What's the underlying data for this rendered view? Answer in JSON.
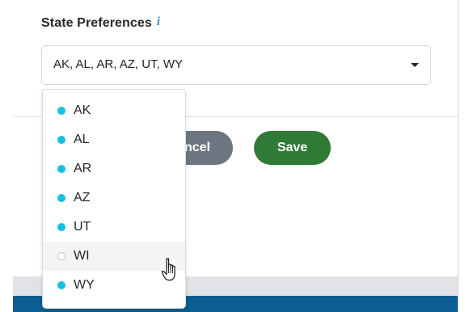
{
  "field": {
    "label": "State Preferences",
    "info_glyph": "i",
    "info_icon": "info-icon",
    "selected_value": "AK, AL, AR, AZ, UT, WY"
  },
  "dropdown": {
    "options": [
      {
        "label": "AK",
        "selected": true
      },
      {
        "label": "AL",
        "selected": true
      },
      {
        "label": "AR",
        "selected": true
      },
      {
        "label": "AZ",
        "selected": true
      },
      {
        "label": "UT",
        "selected": true
      },
      {
        "label": "WI",
        "selected": false,
        "hovered": true
      },
      {
        "label": "WY",
        "selected": true
      }
    ]
  },
  "buttons": {
    "cancel_label": "ncel",
    "save_label": "Save"
  },
  "colors": {
    "selected_dot": "#17bfe0",
    "save_button": "#2f7a35",
    "cancel_button": "#6d7680",
    "footer_bar": "#0b5e91",
    "info_icon": "#2a8ed0"
  }
}
